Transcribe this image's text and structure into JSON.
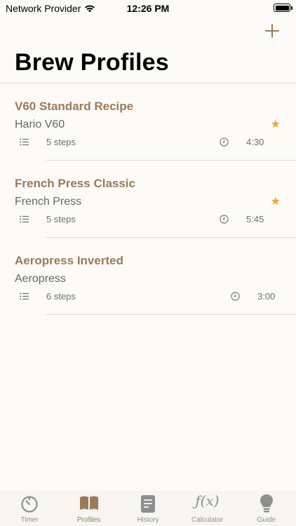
{
  "status_bar": {
    "carrier": "Network Provider",
    "time": "12:26 PM"
  },
  "nav": {
    "add_icon": "plus-icon"
  },
  "page": {
    "title": "Brew Profiles"
  },
  "profiles": [
    {
      "name": "V60 Standard Recipe",
      "device": "Hario V60",
      "steps": "5 steps",
      "duration": "4:30",
      "favorite": true
    },
    {
      "name": "French Press Classic",
      "device": "French Press",
      "steps": "5 steps",
      "duration": "5:45",
      "favorite": true
    },
    {
      "name": "Aeropress Inverted",
      "device": "Aeropress",
      "steps": "6 steps",
      "duration": "3:00",
      "favorite": false
    }
  ],
  "star_glyph": "★",
  "tabs": [
    {
      "label": "Timer",
      "icon": "timer-icon",
      "active": false
    },
    {
      "label": "Profiles",
      "icon": "book-icon",
      "active": true
    },
    {
      "label": "History",
      "icon": "document-icon",
      "active": false
    },
    {
      "label": "Calculator",
      "icon": "function-icon",
      "active": false
    },
    {
      "label": "Guide",
      "icon": "lightbulb-icon",
      "active": false
    }
  ],
  "tab_glyph_fx": "ƒ(x)",
  "colors": {
    "accent": "#9a7b58",
    "star": "#f2a32a",
    "inactive": "#8e8e8e",
    "background": "#fbfaf7"
  }
}
